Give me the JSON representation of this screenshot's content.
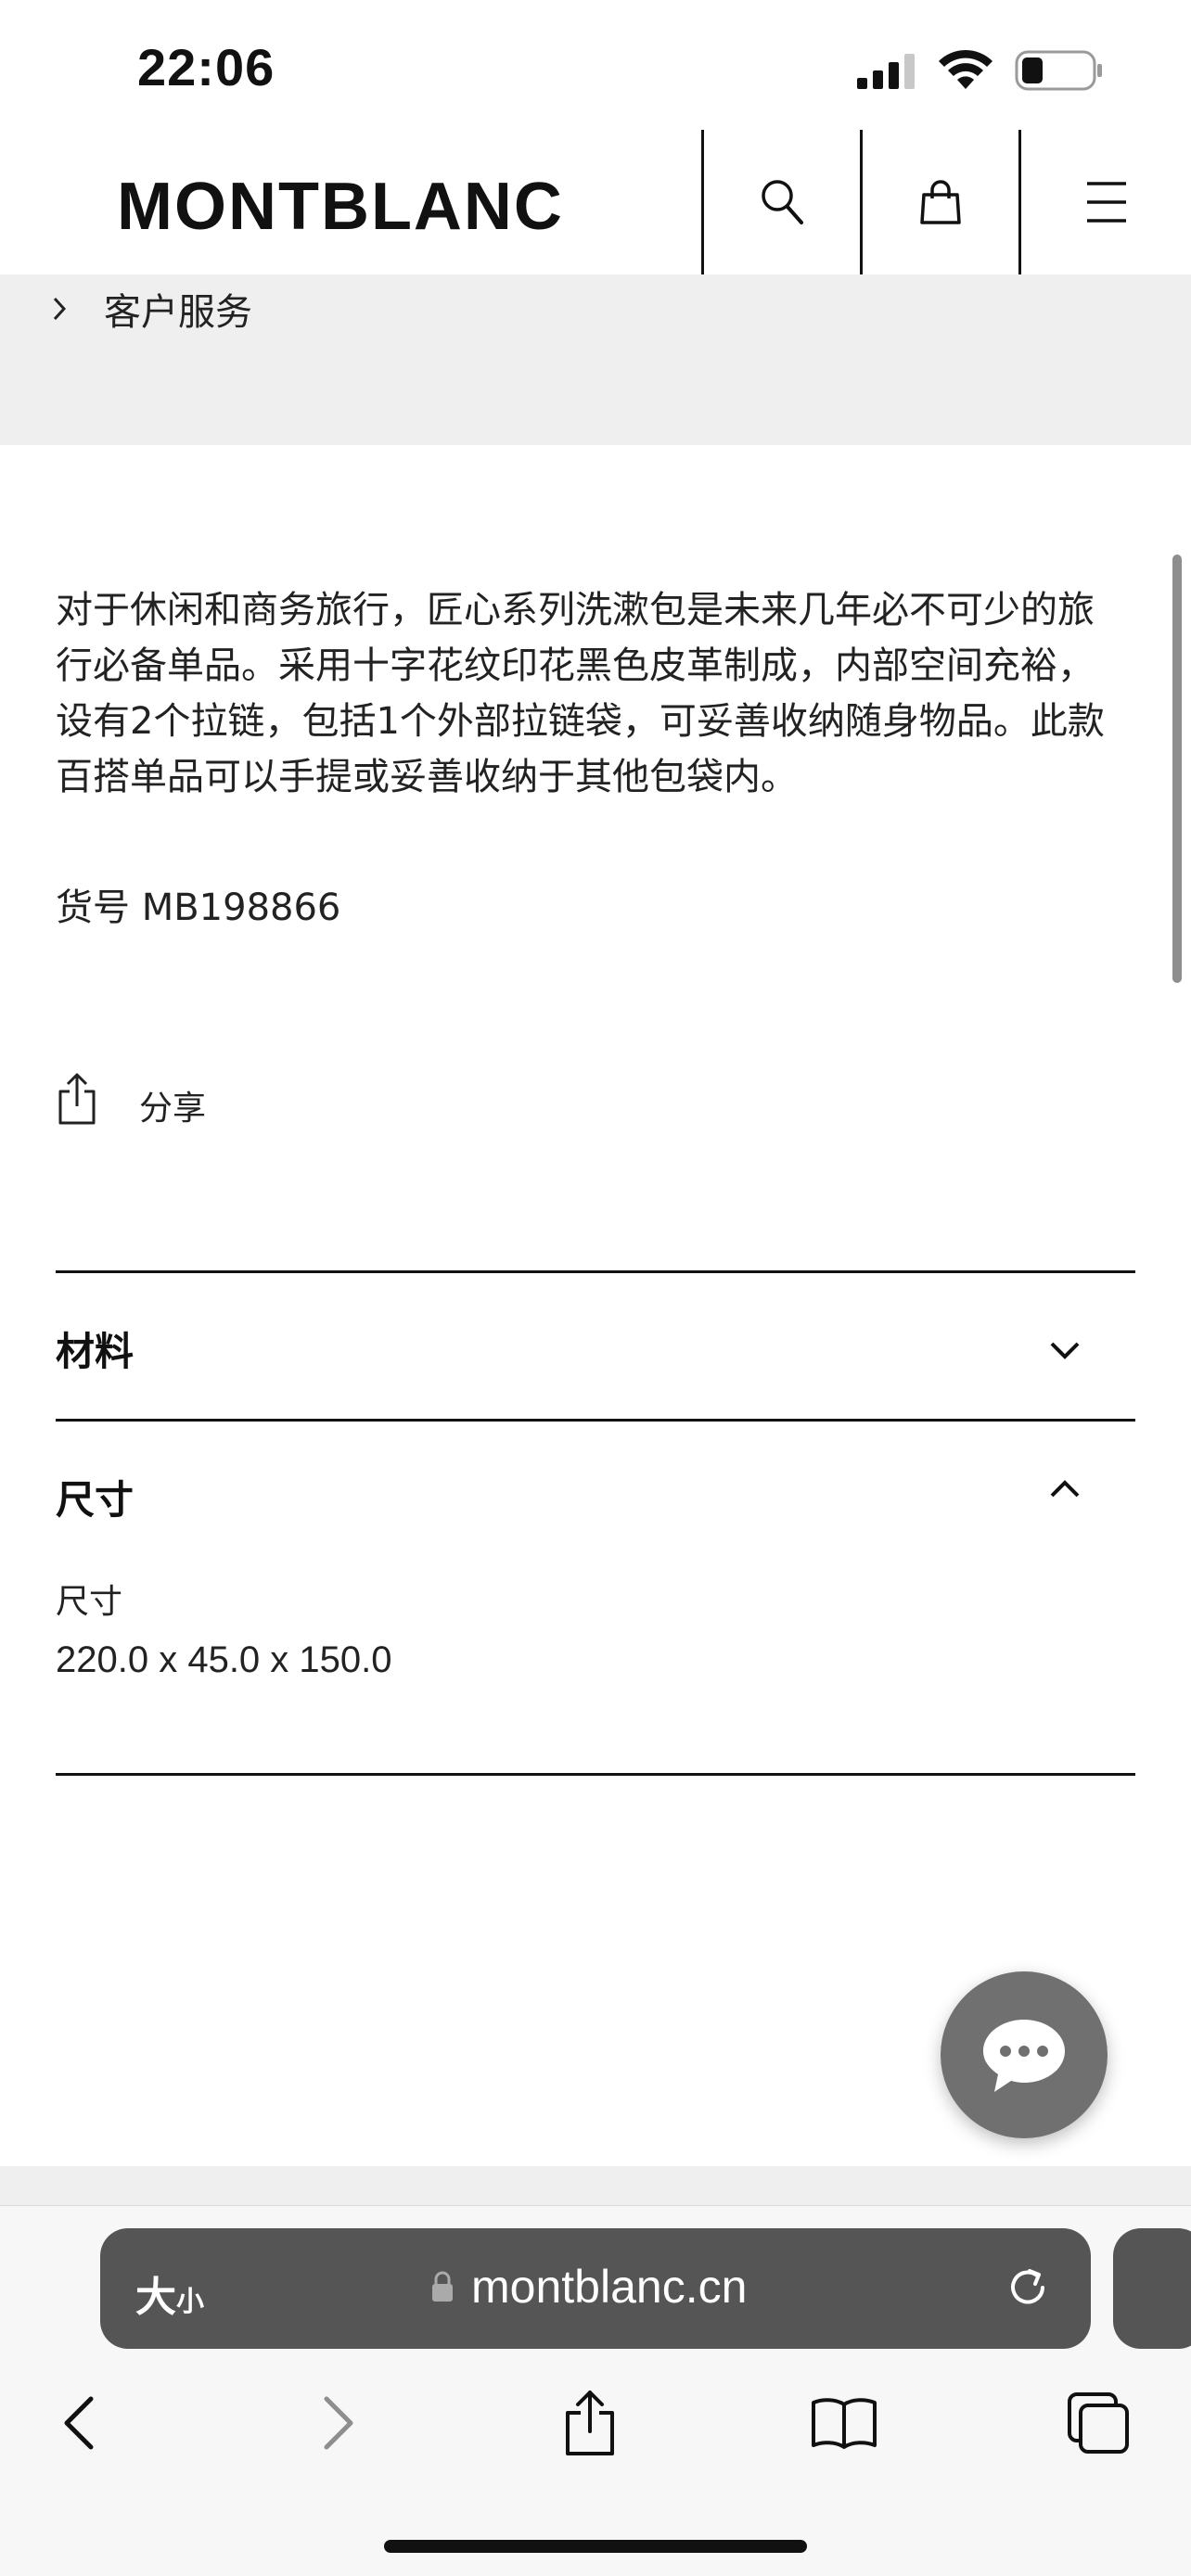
{
  "status_bar": {
    "time": "22:06",
    "icons": [
      "cellular-signal-icon",
      "wifi-icon",
      "battery-icon"
    ]
  },
  "header": {
    "logo": "MONTBLANC",
    "buttons": [
      "search-icon",
      "shopping-bag-icon",
      "menu-icon"
    ]
  },
  "breadcrumb": {
    "label": "客户服务"
  },
  "product": {
    "description": "对于休闲和商务旅行，匠心系列洗漱包是未来几年必不可少的旅行必备单品。采用十字花纹印花黑色皮革制成，内部空间充裕，设有2个拉链，包括1个外部拉链袋，可妥善收纳随身物品。此款百搭单品可以手提或妥善收纳于其他包袋内。",
    "sku": "货号 MB198866",
    "share_label": "分享"
  },
  "accordion": {
    "materials_title": "材料",
    "size_title": "尺寸",
    "size_label": "尺寸",
    "size_value": "220.0 x 45.0 x 150.0"
  },
  "safari": {
    "text_size_label": "大",
    "text_size_small": "小",
    "url": "montblanc.cn"
  },
  "colors": {
    "header_text": "#111111",
    "breadcrumb_bg": "#efefef",
    "chat_fab": "#707070",
    "address_bar": "#555555"
  }
}
